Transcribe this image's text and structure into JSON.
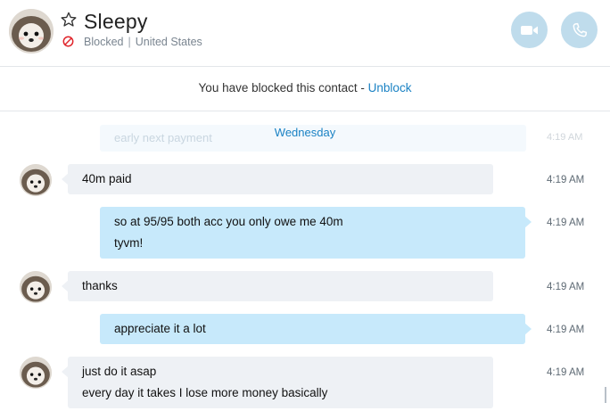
{
  "contact": {
    "name": "Sleepy",
    "status": "Blocked",
    "location": "United States"
  },
  "banner": {
    "text": "You have blocked this contact - ",
    "link": "Unblock"
  },
  "ghost_message": {
    "text": "early next payment",
    "time": "4:19 AM"
  },
  "day_label": "Wednesday",
  "messages": [
    {
      "direction": "in",
      "lines": [
        "40m paid"
      ],
      "time": "4:19 AM"
    },
    {
      "direction": "out",
      "lines": [
        "so at 95/95 both acc you only owe me 40m",
        "tyvm!"
      ],
      "time": "4:19 AM"
    },
    {
      "direction": "in",
      "lines": [
        "thanks"
      ],
      "time": "4:19 AM"
    },
    {
      "direction": "out",
      "lines": [
        "appreciate it a lot"
      ],
      "time": "4:19 AM"
    },
    {
      "direction": "in",
      "lines": [
        "just do it asap",
        "every day it takes I lose more money basically"
      ],
      "time": "4:19 AM"
    }
  ],
  "icons": {
    "favorite": "star-outline-icon",
    "blocked": "blocked-icon",
    "video": "video-call-icon",
    "audio": "phone-call-icon",
    "avatar": "hedgehog-avatar"
  },
  "colors": {
    "accent": "#1a82c4",
    "incoming_bubble": "#eef1f5",
    "outgoing_bubble": "#c7e9fb",
    "call_button": "#bfdcec",
    "blocked_red": "#e0262c"
  }
}
